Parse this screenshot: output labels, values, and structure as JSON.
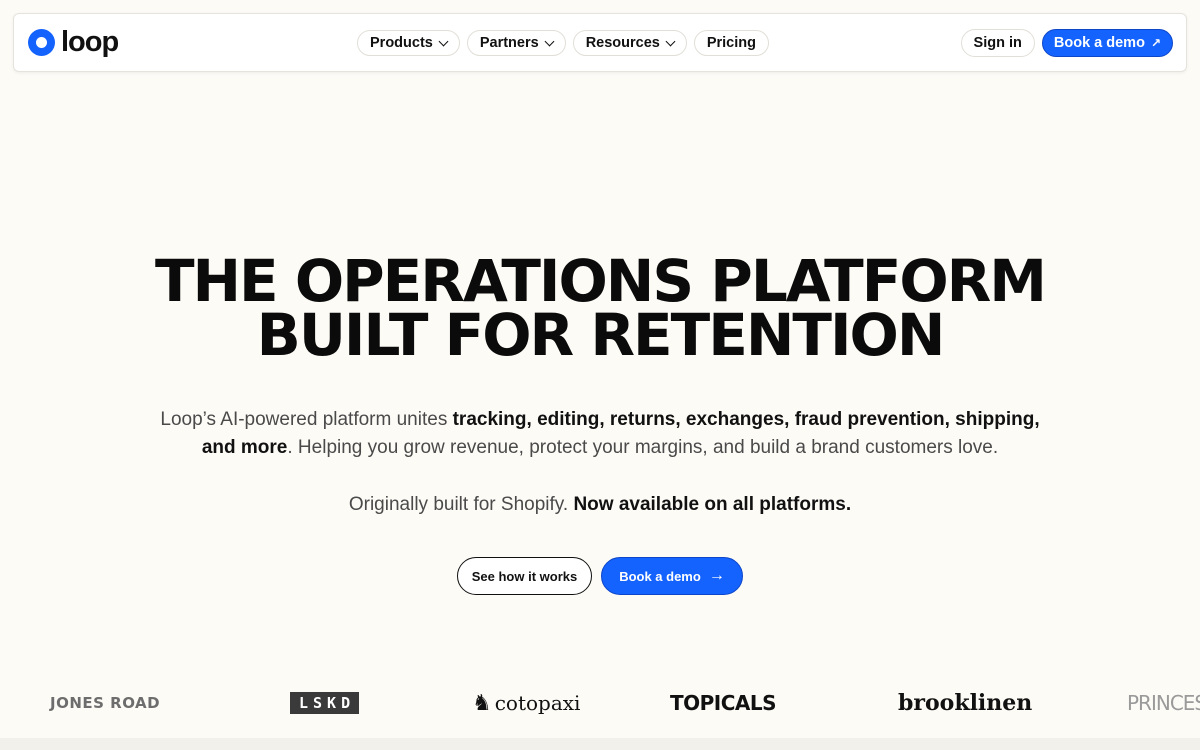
{
  "brand": {
    "name": "loop",
    "accent": "#1463ff",
    "background": "#fdfbf6"
  },
  "nav": {
    "items": [
      {
        "label": "Products",
        "has_dropdown": true
      },
      {
        "label": "Partners",
        "has_dropdown": true
      },
      {
        "label": "Resources",
        "has_dropdown": true
      },
      {
        "label": "Pricing",
        "has_dropdown": false
      }
    ],
    "signin_label": "Sign in",
    "demo_label": "Book a demo",
    "demo_icon": "arrow-up-right-icon"
  },
  "hero": {
    "headline_line1": "THE OPERATIONS PLATFORM",
    "headline_line2": "BUILT FOR RETENTION",
    "sub_pre": "Loop’s AI-powered platform unites ",
    "sub_bold": "tracking, editing, returns, exchanges, fraud prevention, shipping, and more",
    "sub_post": ". Helping you grow revenue, protect your margins, and build a brand customers love.",
    "sub2_pre": "Originally built for Shopify. ",
    "sub2_bold": "Now available on all platforms.",
    "cta_secondary": "See how it works",
    "cta_primary": "Book a demo",
    "cta_primary_icon": "arrow-right-icon"
  },
  "customer_logos": [
    {
      "name": "JONES ROAD"
    },
    {
      "name": "LSKD"
    },
    {
      "name": "cotopaxi",
      "icon": "llama-icon"
    },
    {
      "name": "TOPICALS"
    },
    {
      "name": "brooklinen"
    },
    {
      "name": "PRINCESS"
    }
  ]
}
